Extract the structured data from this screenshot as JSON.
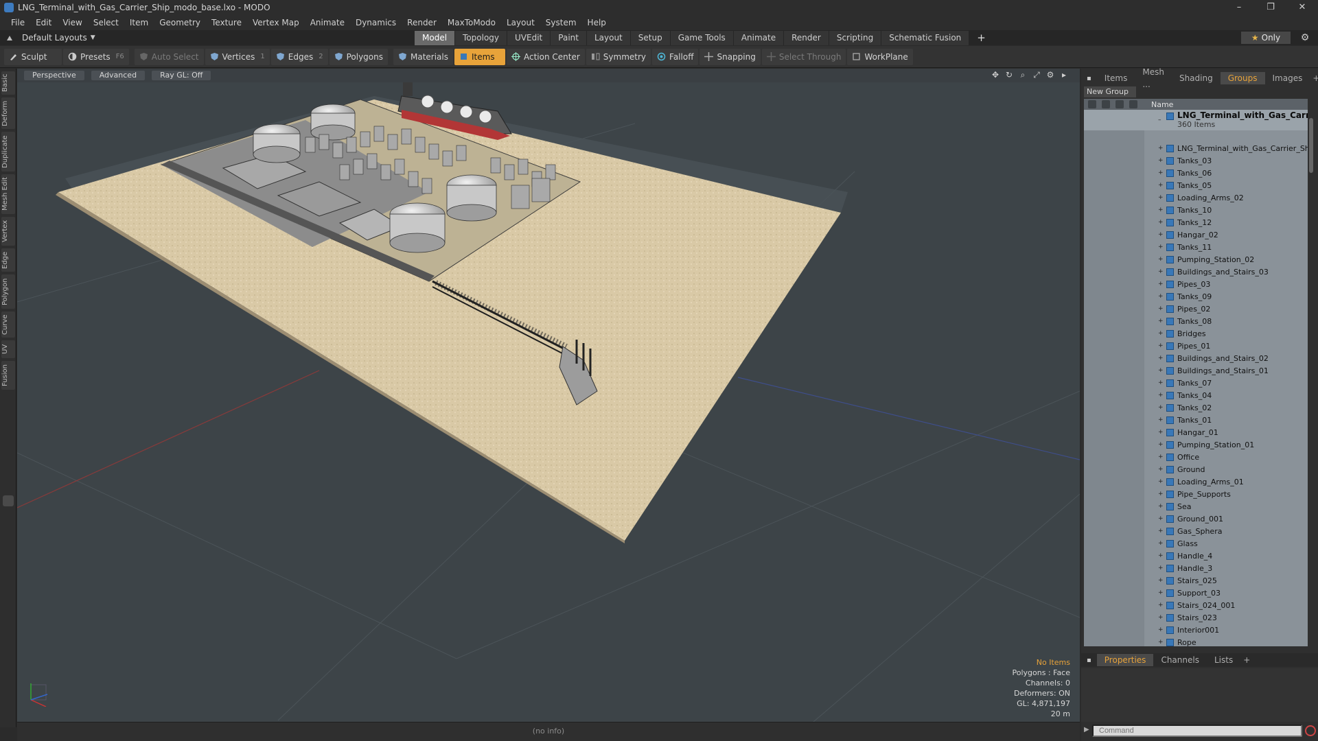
{
  "window": {
    "title": "LNG_Terminal_with_Gas_Carrier_Ship_modo_base.lxo - MODO",
    "controls": [
      "–",
      "❐",
      "✕"
    ]
  },
  "menu": [
    "File",
    "Edit",
    "View",
    "Select",
    "Item",
    "Geometry",
    "Texture",
    "Vertex Map",
    "Animate",
    "Dynamics",
    "Render",
    "MaxToModo",
    "Layout",
    "System",
    "Help"
  ],
  "layout": {
    "current": "Default Layouts",
    "tabs": [
      "Model",
      "Topology",
      "UVEdit",
      "Paint",
      "Layout",
      "Setup",
      "Game Tools",
      "Animate",
      "Render",
      "Scripting",
      "Schematic Fusion"
    ],
    "active_tab": "Model",
    "only_label": "Only"
  },
  "toolbar": {
    "sculpt": "Sculpt",
    "presets": "Presets",
    "presets_key": "F6",
    "auto_select": "Auto Select",
    "vertices": "Vertices",
    "vertices_key": "1",
    "edges": "Edges",
    "edges_key": "2",
    "polygons": "Polygons",
    "materials": "Materials",
    "items": "Items",
    "action_center": "Action Center",
    "symmetry": "Symmetry",
    "falloff": "Falloff",
    "snapping": "Snapping",
    "select_through": "Select Through",
    "workplane": "WorkPlane"
  },
  "left_tabs": [
    "Basic",
    "Deform",
    "Duplicate",
    "Mesh Edit",
    "Vertex",
    "Edge",
    "Polygon",
    "Curve",
    "UV",
    "Fusion"
  ],
  "viewport": {
    "view": "Perspective",
    "shading": "Advanced",
    "raygl": "Ray GL: Off",
    "info": {
      "selection": "No Items",
      "polygons": "Polygons : Face",
      "channels": "Channels: 0",
      "deformers": "Deformers: ON",
      "gl": "GL: 4,871,197",
      "scale": "20 m"
    }
  },
  "status": "(no info)",
  "right_panel": {
    "tabs": [
      "Items",
      "Mesh ...",
      "Shading",
      "Groups",
      "Images"
    ],
    "active_tab": "Groups",
    "new_group": "New Group",
    "column_name": "Name",
    "root": {
      "label": "LNG_Terminal_with_Gas_Carrier...",
      "count": "360 Items"
    },
    "items": [
      "LNG_Terminal_with_Gas_Carrier_Ship",
      "Tanks_03",
      "Tanks_06",
      "Tanks_05",
      "Loading_Arms_02",
      "Tanks_10",
      "Tanks_12",
      "Hangar_02",
      "Tanks_11",
      "Pumping_Station_02",
      "Buildings_and_Stairs_03",
      "Pipes_03",
      "Tanks_09",
      "Pipes_02",
      "Tanks_08",
      "Bridges",
      "Pipes_01",
      "Buildings_and_Stairs_02",
      "Buildings_and_Stairs_01",
      "Tanks_07",
      "Tanks_04",
      "Tanks_02",
      "Tanks_01",
      "Hangar_01",
      "Pumping_Station_01",
      "Office",
      "Ground",
      "Loading_Arms_01",
      "Pipe_Supports",
      "Sea",
      "Ground_001",
      "Gas_Sphera",
      "Glass",
      "Handle_4",
      "Handle_3",
      "Stairs_025",
      "Support_03",
      "Stairs_024_001",
      "Stairs_023",
      "Interior001",
      "Rope"
    ],
    "prop_tabs": [
      "Properties",
      "Channels",
      "Lists"
    ],
    "active_prop_tab": "Properties",
    "command_placeholder": "Command"
  },
  "colors": {
    "accent": "#e8a33a",
    "viewport_bg": "#3d4448",
    "ground": "#d8c8a8",
    "item_icon": "#3978b8"
  }
}
